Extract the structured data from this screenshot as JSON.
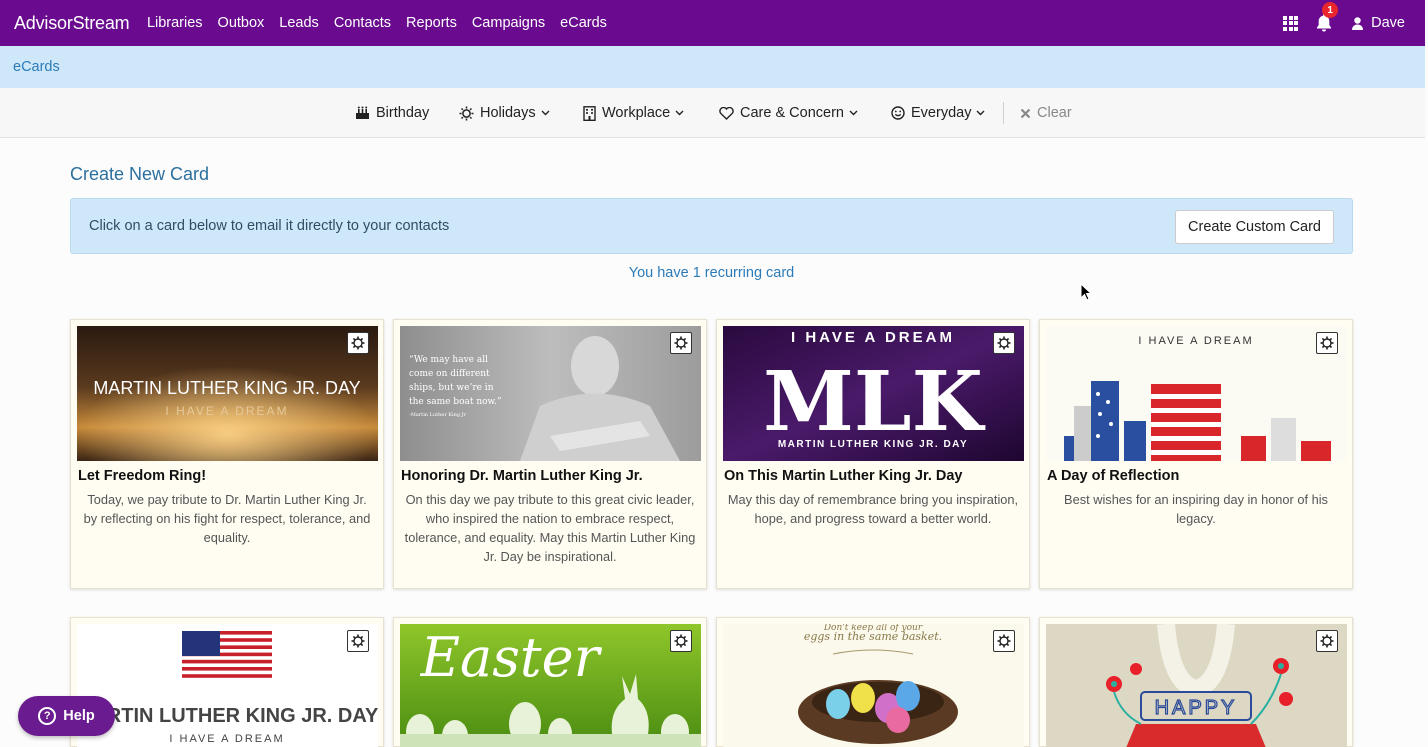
{
  "nav": {
    "brand": "AdvisorStream",
    "links": [
      "Libraries",
      "Outbox",
      "Leads",
      "Contacts",
      "Reports",
      "Campaigns",
      "eCards"
    ],
    "notification_count": "1",
    "user_name": "Dave",
    "colors": {
      "bar": "#6a0b8f",
      "badge": "#e8262b"
    }
  },
  "breadcrumb": {
    "current": "eCards"
  },
  "filters": {
    "birthday": "Birthday",
    "holidays": "Holidays",
    "workplace": "Workplace",
    "care": "Care & Concern",
    "everyday": "Everyday",
    "clear": "Clear"
  },
  "main": {
    "section_title": "Create New Card",
    "info_message": "Click on a card below to email it directly to your contacts",
    "custom_button": "Create Custom Card",
    "recurring_link": "You have 1 recurring card"
  },
  "cards": [
    {
      "title": "Let Freedom Ring!",
      "description": "Today, we pay tribute to Dr. Martin Luther King Jr. by reflecting on his fight for respect, tolerance, and equality.",
      "image_text": [
        "MARTIN LUTHER KING JR. DAY",
        "I HAVE A DREAM"
      ]
    },
    {
      "title": "Honoring Dr. Martin Luther King Jr.",
      "description": "On this day we pay tribute to this great civic leader, who inspired the nation to embrace respect, tolerance, and equality. May this Martin Luther King Jr. Day be inspirational.",
      "image_text": [
        "“We may have all",
        "come on different",
        "ships, but we’re in",
        "the same boat now.”",
        "-Martin Luther King Jr"
      ]
    },
    {
      "title": "On This Martin Luther King Jr. Day",
      "description": "May this day of remembrance bring you inspiration, hope, and progress toward a better world.",
      "image_text": [
        "I HAVE A DREAM",
        "MLK",
        "MARTIN LUTHER KING JR. DAY"
      ]
    },
    {
      "title": "A Day of Reflection",
      "description": "Best wishes for an inspiring day in honor of his legacy.",
      "image_text": [
        "I HAVE A DREAM"
      ]
    },
    {
      "image_text": [
        "MARTIN LUTHER KING JR. DAY",
        "I HAVE A DREAM"
      ]
    },
    {
      "image_text": [
        "Easter"
      ]
    },
    {
      "image_text": [
        "Don't keep all of your",
        "eggs in the same basket."
      ]
    },
    {
      "image_text": [
        "HAPPY"
      ]
    }
  ],
  "help": {
    "label": "Help"
  }
}
